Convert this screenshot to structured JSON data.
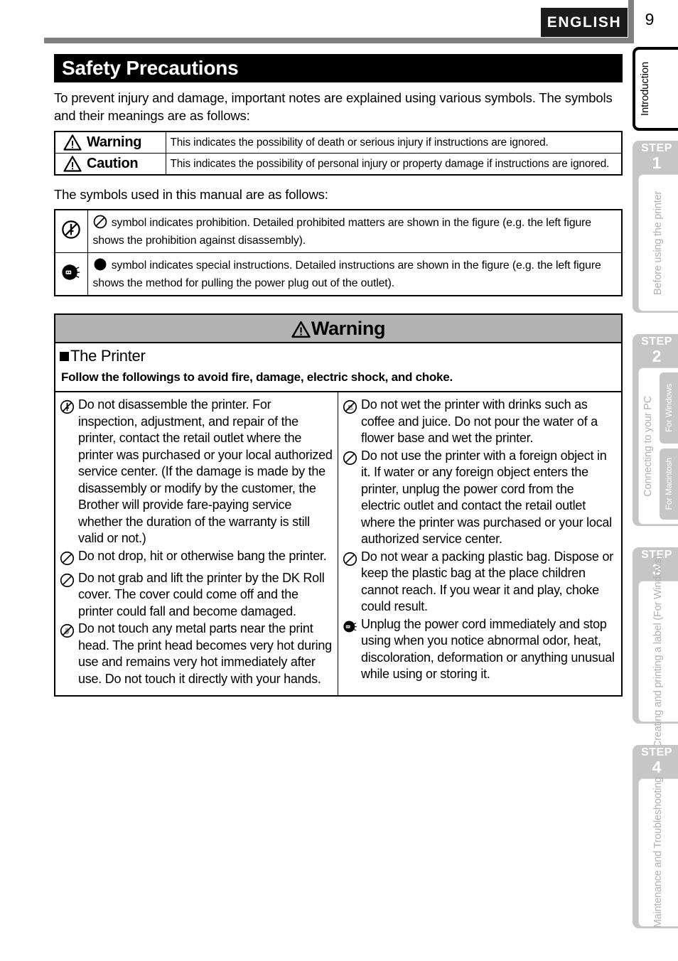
{
  "header": {
    "language_badge": "ENGLISH",
    "page_number": "9"
  },
  "title": "Safety Precautions",
  "intro_text": "To prevent injury and damage, important notes are explained using various symbols. The symbols and their meanings are as follows:",
  "definition_table": {
    "rows": [
      {
        "icon": "warning-triangle-icon",
        "label": "Warning",
        "description": "This indicates the possibility of death or serious injury if instructions are ignored."
      },
      {
        "icon": "warning-triangle-icon",
        "label": "Caution",
        "description": "This indicates the possibility of personal injury or property damage if instructions are ignored."
      }
    ]
  },
  "symbols_lead": "The symbols used in this manual are as follows:",
  "symbol_table": {
    "rows": [
      {
        "icon": "no-disassembly-icon",
        "description": "symbol indicates prohibition. Detailed prohibited matters are shown in the figure (e.g. the left figure shows the prohibition against disassembly)."
      },
      {
        "icon": "unplug-power-plug-icon",
        "description": "symbol indicates special instructions. Detailed instructions are shown in the figure (e.g. the left figure shows the method for pulling the power plug out of the outlet)."
      }
    ]
  },
  "warning_box": {
    "heading": "Warning",
    "subheading": "The Printer",
    "follow_line": "Follow the followings to avoid fire, damage, electric shock, and choke.",
    "left_column": [
      {
        "icon": "no-disassembly-icon",
        "text": "Do not disassemble the printer. For inspection, adjustment, and repair of the printer, contact the retail outlet where the printer was purchased or your local authorized service center. (If the damage is made by the disassembly or modify by the customer, the Brother will provide fare-paying service whether the duration of the warranty is still valid or not.)"
      },
      {
        "icon": "prohibition-icon",
        "text": "Do not drop, hit or otherwise bang the printer."
      },
      {
        "icon": "prohibition-icon",
        "text": "Do not grab and lift the printer by the DK Roll cover. The cover could come off and the printer could fall and become damaged."
      },
      {
        "icon": "no-touch-hand-icon",
        "text": "Do not touch any metal parts near the print head. The print head becomes very hot during use and remains very hot immediately after use. Do not touch it directly with your hands."
      }
    ],
    "right_column": [
      {
        "icon": "no-liquid-icon",
        "text": "Do not wet the printer with drinks such as coffee and juice. Do not pour the water of a flower base and wet the printer."
      },
      {
        "icon": "prohibition-icon",
        "text": "Do not use the printer with a foreign object in it. If water or any foreign object enters the printer, unplug the power cord from the electric outlet and contact the retail outlet where the printer was purchased or your local authorized service center."
      },
      {
        "icon": "prohibition-icon",
        "text": "Do not wear a packing plastic bag. Dispose or keep the plastic bag at the place children cannot reach. If you wear it and play, choke could result."
      },
      {
        "icon": "unplug-power-plug-icon",
        "text": "Unplug the power cord immediately and stop using when you notice abnormal odor, heat, discoloration, deformation or anything unusual while using or storing it."
      }
    ]
  },
  "rail": {
    "intro_label": "Introduction",
    "steps": [
      {
        "step_word": "STEP",
        "step_number": "1",
        "body_label": "Before using the printer",
        "subtabs": []
      },
      {
        "step_word": "STEP",
        "step_number": "2",
        "body_label": "Connecting to your PC",
        "subtabs": [
          "For Windows",
          "For Macintosh"
        ]
      },
      {
        "step_word": "STEP",
        "step_number": "3",
        "body_label": "Creating and printing a label (For Windows)",
        "subtabs": []
      },
      {
        "step_word": "STEP",
        "step_number": "4",
        "body_label": "Maintenance and Troubleshooting",
        "subtabs": []
      }
    ]
  },
  "colors": {
    "title_bg": "#000000",
    "warning_head_bg": "#b3b3b3",
    "rail_step_bg": "#c6c6c6",
    "rail_text": "#b0b0b0",
    "header_rule": "#808080"
  }
}
